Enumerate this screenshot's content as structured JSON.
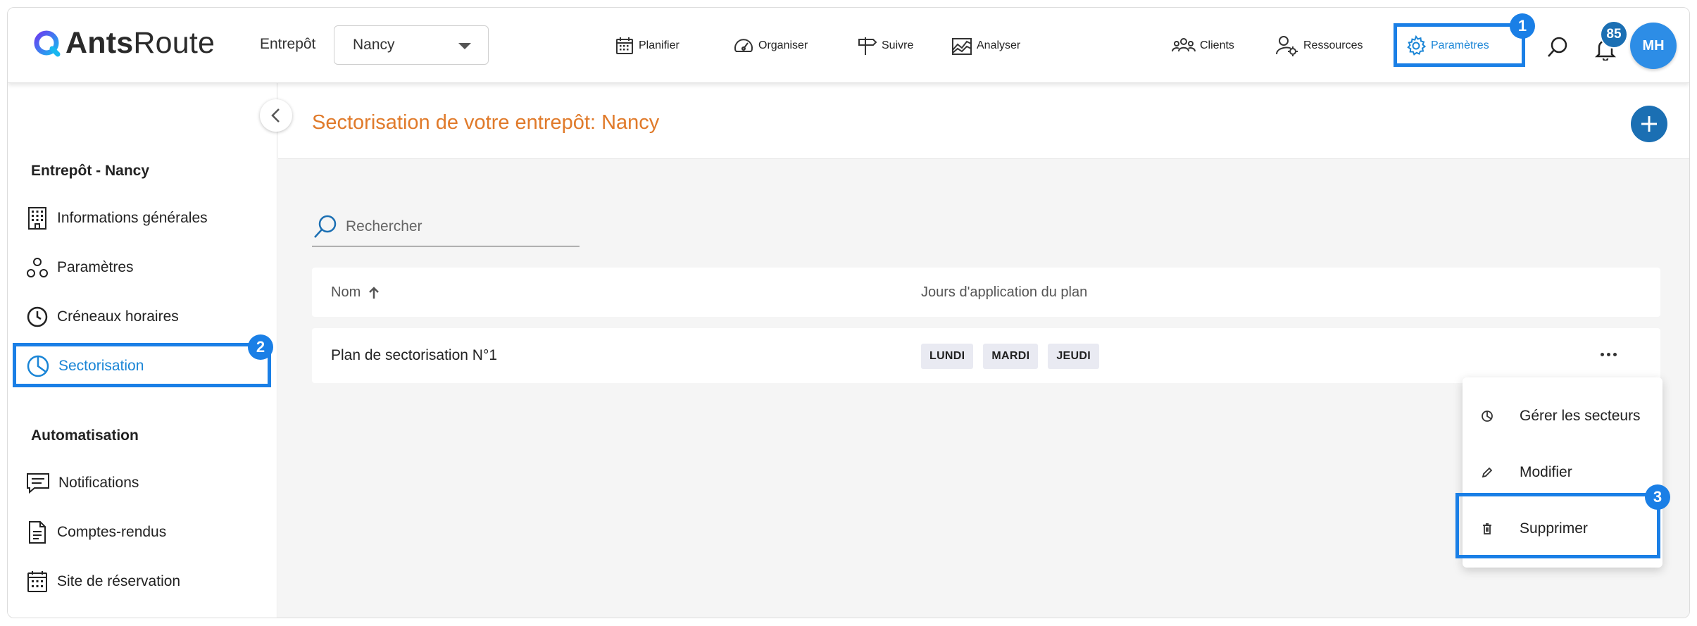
{
  "app": {
    "logo": {
      "bold": "Ants",
      "regular": "Route"
    },
    "warehouse_label": "Entrepôt",
    "warehouse_value": "Nancy"
  },
  "nav": {
    "planifier": "Planifier",
    "organiser": "Organiser",
    "suivre": "Suivre",
    "analyser": "Analyser",
    "clients": "Clients",
    "ressources": "Ressources",
    "parametres": "Paramètres",
    "notification_count": "85",
    "avatar_initials": "MH"
  },
  "steps": {
    "one": "1",
    "two": "2",
    "three": "3"
  },
  "sidebar": {
    "section_warehouse": "Entrepôt - Nancy",
    "items_warehouse": [
      {
        "label": "Informations générales",
        "icon": "building-icon"
      },
      {
        "label": "Paramètres",
        "icon": "molecule-icon"
      },
      {
        "label": "Créneaux horaires",
        "icon": "clock-icon"
      },
      {
        "label": "Sectorisation",
        "icon": "pie-chart-icon",
        "active": true
      }
    ],
    "section_automation": "Automatisation",
    "items_automation": [
      {
        "label": "Notifications",
        "icon": "message-icon"
      },
      {
        "label": "Comptes-rendus",
        "icon": "document-icon"
      },
      {
        "label": "Site de réservation",
        "icon": "calendar-icon"
      }
    ]
  },
  "main": {
    "title": "Sectorisation de votre entrepôt: Nancy",
    "search_placeholder": "Rechercher",
    "columns": {
      "name": "Nom",
      "days": "Jours d'application du plan"
    },
    "rows": [
      {
        "name": "Plan de sectorisation N°1",
        "days": [
          "LUNDI",
          "MARDI",
          "JEUDI"
        ]
      }
    ]
  },
  "row_menu": {
    "items": [
      {
        "label": "Gérer les secteurs",
        "icon": "pie-chart-icon"
      },
      {
        "label": "Modifier",
        "icon": "pencil-icon"
      },
      {
        "label": "Supprimer",
        "icon": "trash-icon"
      }
    ]
  },
  "colors": {
    "accent": "#1a7fe6",
    "title_orange": "#e07a2a",
    "primary_button": "#1b6fb3"
  }
}
